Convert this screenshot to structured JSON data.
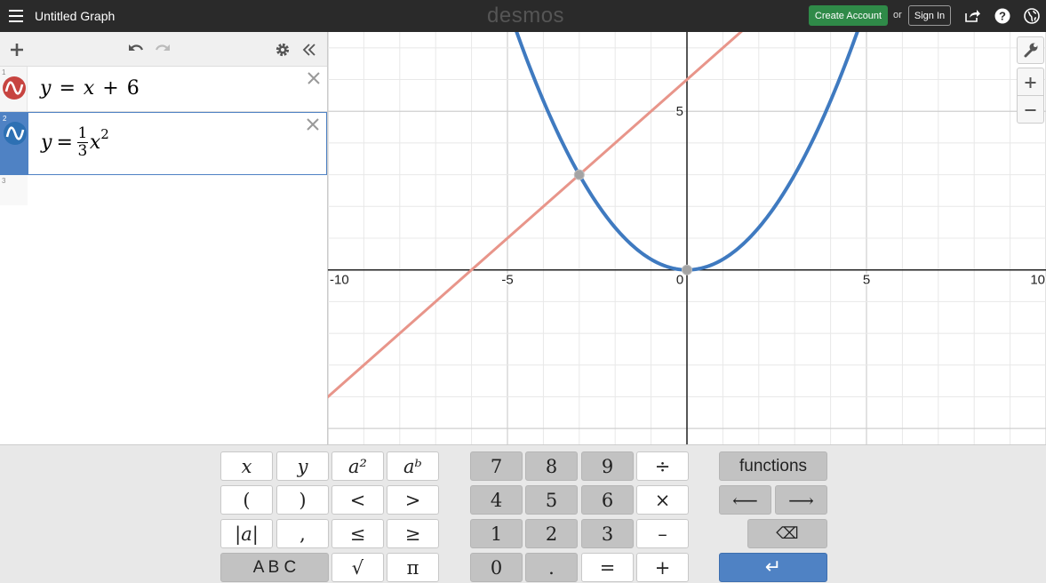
{
  "header": {
    "title": "Untitled Graph",
    "logo": "desmos",
    "create_account": "Create Account",
    "or": "or",
    "sign_in": "Sign In",
    "icons": [
      "menu-icon",
      "share-icon",
      "help-icon",
      "language-icon"
    ]
  },
  "expressions": [
    {
      "number": "1",
      "latex_text": "y = x + 6",
      "color": "#c74440",
      "lhs": "y",
      "rhs_x": "x",
      "rhs_op": "+",
      "rhs_const": "6"
    },
    {
      "number": "2",
      "latex_text": "y = 1/3 x^2",
      "color": "#2d70b3",
      "lhs": "y",
      "num": "1",
      "den": "3",
      "var": "x",
      "exp": "2",
      "selected": true
    },
    {
      "number": "3",
      "latex_text": ""
    }
  ],
  "graph": {
    "x_range": [
      -10,
      10
    ],
    "y_range": [
      -5.5,
      7.5
    ],
    "x_tick_labels": [
      "-10",
      "-5",
      "0",
      "5",
      "10"
    ],
    "y_tick_labels": [
      "5"
    ],
    "line_color": "#e8958a",
    "parabola_color": "#3f7ac0",
    "points": [
      {
        "x": -3.0,
        "y": 3.0
      },
      {
        "x": 0.0,
        "y": 0.0
      }
    ]
  },
  "keypad": {
    "left": [
      [
        "x",
        "y",
        "a²",
        "aᵇ"
      ],
      [
        "(",
        ")",
        "<",
        ">"
      ],
      [
        "|a|",
        ",",
        "≤",
        "≥"
      ],
      [
        "A B C",
        "√",
        "π"
      ]
    ],
    "middle": [
      [
        "7",
        "8",
        "9",
        "÷"
      ],
      [
        "4",
        "5",
        "6",
        "×"
      ],
      [
        "1",
        "2",
        "3",
        "–"
      ],
      [
        "0",
        ".",
        "=",
        "+"
      ]
    ],
    "functions_label": "functions",
    "left_arrow": "⟵",
    "right_arrow": "⟶",
    "backspace": "⌫",
    "enter": "↵"
  }
}
